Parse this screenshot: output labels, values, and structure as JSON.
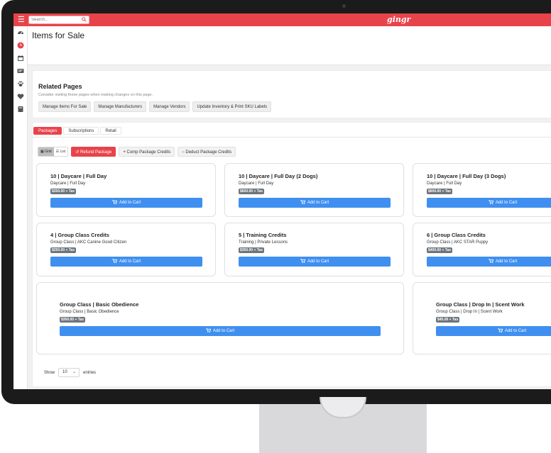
{
  "topbar": {
    "search_placeholder": "Search...",
    "brand": "gingr"
  },
  "page": {
    "title": "Items for Sale"
  },
  "related": {
    "title": "Related Pages",
    "subtitle": "Consider visiting these pages when making changes on this page.",
    "links": [
      "Manage Items For Sale",
      "Manage Manufacturers",
      "Manage Vendors",
      "Update Inventory & Print SKU Labels"
    ]
  },
  "tabs": [
    "Packages",
    "Subscriptions",
    "Retail"
  ],
  "toolbar": {
    "grid_label": "Grid",
    "list_label": "List",
    "refund_label": "Refund Package",
    "comp_label": "Comp Package Credits",
    "deduct_label": "Deduct Package Credits"
  },
  "cards": [
    {
      "title": "10 | Daycare | Full Day",
      "sub": "Daycare | Full Day",
      "price": "$350.00 + Tax",
      "button": "Add to Cart"
    },
    {
      "title": "10 | Daycare | Full Day (2 Dogs)",
      "sub": "Daycare | Full Day",
      "price": "$600.00 + Tax",
      "button": "Add to Cart"
    },
    {
      "title": "10 | Daycare | Full Day (3 Dogs)",
      "sub": "Daycare | Full Day",
      "price": "$600.00 + Tax",
      "button": "Add to Cart"
    },
    {
      "title": "4 | Group Class Credits",
      "sub": "Group Class | AKC Canine Good Citizen",
      "price": "$250.00 + Tax",
      "button": "Add to Cart"
    },
    {
      "title": "5 | Training Credits",
      "sub": "Training | Private Lessons",
      "price": "$350.00 + Tax",
      "button": "Add to Cart"
    },
    {
      "title": "6 | Group Class Credits",
      "sub": "Group Class | AKC STAR Puppy",
      "price": "$400.00 + Tax",
      "button": "Add to Cart"
    },
    {
      "title": "Group Class | Basic Obedience",
      "sub": "Group Class | Basic Obedience",
      "price": "$350.00 + Tax",
      "button": "Add to Cart"
    },
    {
      "title": "Group Class | Drop In | Scent Work",
      "sub": "Group Class | Drop In | Scent Work",
      "price": "$45.00 + Tax",
      "button": "Add to Cart"
    }
  ],
  "footer": {
    "show_label": "Show",
    "entries_value": "10",
    "entries_label": "entries"
  },
  "colors": {
    "brand_red": "#e8434b",
    "primary_blue": "#3f8ff0"
  }
}
